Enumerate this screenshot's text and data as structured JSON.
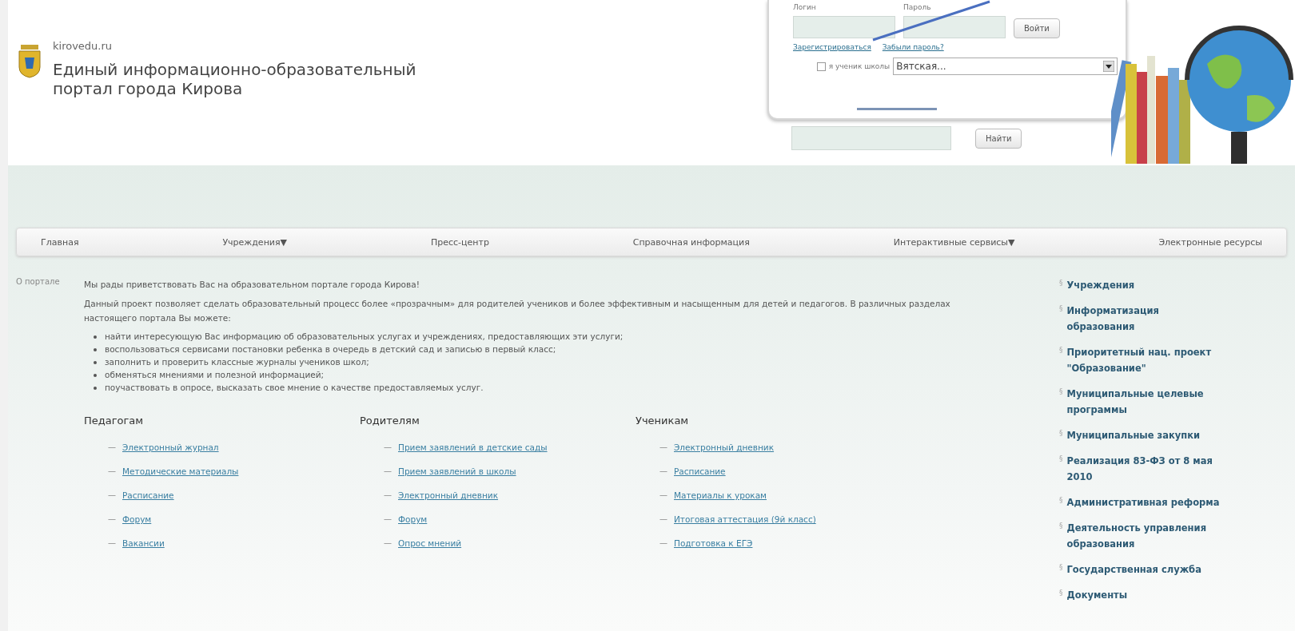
{
  "header": {
    "domain": "kirovedu.ru",
    "title_line_1": "Единый информационно-образовательный",
    "title_line_2": "портал города Кирова"
  },
  "login": {
    "login_label": "Логин",
    "password_label": "Пароль",
    "submit": "Войти",
    "register_link": "Зарегистрироваться",
    "forgot_link": "Забыли пароль?",
    "student_checkbox": {
      "label": "я ученик школы",
      "checked": false
    },
    "school_select": "Вятская..."
  },
  "search": {
    "button": "Найти"
  },
  "nav": [
    {
      "label": "Главная"
    },
    {
      "label": "Учреждения",
      "arrow": "▼"
    },
    {
      "label": "Пресс-центр"
    },
    {
      "label": "Справочная информация"
    },
    {
      "label": "Интерактивные сервисы",
      "arrow": "▼"
    },
    {
      "label": "Электронные ресурсы"
    }
  ],
  "section_label": "О портале",
  "intro": {
    "greeting": "Мы рады приветствовать Вас на образовательном портале города Кирова!",
    "paragraph": "Данный проект позволяет сделать образовательный процесс более «прозрачным» для родителей учеников и более эффективным и насыщенным для детей и педагогов. В различных разделах настоящего портала Вы можете:",
    "bullets": [
      "найти интересующую Вас информацию об образовательных услугах и учреждениях, предоставляющих эти услуги;",
      "воспользоваться сервисами постановки ребенка в очередь в детский сад и записью в первый класс;",
      "заполнить и проверить классные журналы учеников школ;",
      "обменяться мнениями и полезной информацией;",
      "поучаствовать в опросе, высказать свое мнение о качестве предоставляемых услуг."
    ]
  },
  "columns": [
    {
      "heading": "Педагогам",
      "links": [
        "Электронный журнал",
        "Методические материалы",
        "Расписание",
        "Форум",
        "Вакансии"
      ]
    },
    {
      "heading": "Родителям",
      "links": [
        "Прием заявлений в детские сады",
        "Прием заявлений в школы",
        "Электронный дневник",
        "Форум",
        "Опрос мнений"
      ]
    },
    {
      "heading": "Ученикам",
      "links": [
        "Электронный дневник",
        "Расписание",
        "Материалы к урокам",
        "Итоговая аттестация (9й класс)",
        "Подготовка к ЕГЭ"
      ]
    }
  ],
  "list_dash": "—",
  "sidebar": {
    "marker": "§",
    "items": [
      "Учреждения",
      "Информатизация образования",
      "Приоритетный нац. проект \"Образование\"",
      "Муниципальные целевые программы",
      "Муниципальные закупки",
      "Реализация 83-ФЗ от 8 мая 2010",
      "Административная реформа",
      "Деятельность управления образования",
      "Государственная служба",
      "Документы"
    ]
  }
}
